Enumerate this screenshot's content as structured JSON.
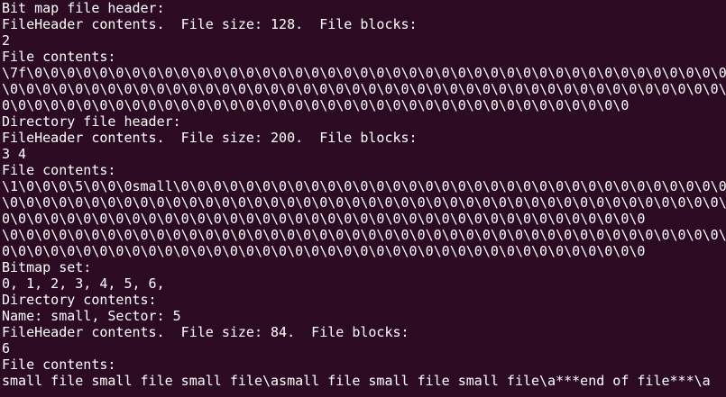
{
  "terminal": {
    "lines": [
      "Bit map file header:",
      "FileHeader contents.  File size: 128.  File blocks:",
      "2",
      "File contents:",
      "\\7f\\0\\0\\0\\0\\0\\0\\0\\0\\0\\0\\0\\0\\0\\0\\0\\0\\0\\0\\0\\0\\0\\0\\0\\0\\0\\0\\0\\0\\0\\0\\0\\0\\0\\0\\0\\0\\0\\0\\0\\0\\0\\0\\0\\0",
      "\\0\\0\\0\\0\\0\\0\\0\\0\\0\\0\\0\\0\\0\\0\\0\\0\\0\\0\\0\\0\\0\\0\\0\\0\\0\\0\\0\\0\\0\\0\\0\\0\\0\\0\\0\\0\\0\\0\\0\\0\\0\\0\\0\\0\\0",
      "0\\0\\0\\0\\0\\0\\0\\0\\0\\0\\0\\0\\0\\0\\0\\0\\0\\0\\0\\0\\0\\0\\0\\0\\0\\0\\0\\0\\0\\0\\0\\0\\0\\0\\0\\0\\0\\0\\0",
      "Directory file header:",
      "FileHeader contents.  File size: 200.  File blocks:",
      "3 4",
      "File contents:",
      "\\1\\0\\0\\0\\5\\0\\0\\0small\\0\\0\\0\\0\\0\\0\\0\\0\\0\\0\\0\\0\\0\\0\\0\\0\\0\\0\\0\\0\\0\\0\\0\\0\\0\\0\\0\\0\\0\\0\\0\\0\\0\\0\\0",
      "\\0\\0\\0\\0\\0\\0\\0\\0\\0\\0\\0\\0\\0\\0\\0\\0\\0\\0\\0\\0\\0\\0\\0\\0\\0\\0\\0\\0\\0\\0\\0\\0\\0\\0\\0\\0\\0\\0\\0\\0\\0\\0\\0\\0\\0",
      "0\\0\\0\\0\\0\\0\\0\\0\\0\\0\\0\\0\\0\\0\\0\\0\\0\\0\\0\\0\\0\\0\\0\\0\\0\\0\\0\\0\\0\\0\\0\\0\\0\\0\\0\\0\\0\\0\\0\\0",
      "\\0\\0\\0\\0\\0\\0\\0\\0\\0\\0\\0\\0\\0\\0\\0\\0\\0\\0\\0\\0\\0\\0\\0\\0\\0\\0\\0\\0\\0\\0\\0\\0\\0\\0\\0\\0\\0\\0\\0\\0\\0\\0\\0\\0\\0",
      "0\\0\\0\\0\\0\\0\\0\\0\\0\\0\\0\\0\\0\\0\\0\\0\\0\\0\\0\\0\\0\\0\\0\\0\\0\\0\\0\\0\\0\\0\\0\\0\\0\\0\\0\\0\\0\\0\\0\\0",
      "Bitmap set:",
      "0, 1, 2, 3, 4, 5, 6,",
      "Directory contents:",
      "Name: small, Sector: 5",
      "FileHeader contents.  File size: 84.  File blocks:",
      "6",
      "File contents:",
      "small file small file small file\\asmall file small file small file\\a***end of file***\\a"
    ]
  }
}
